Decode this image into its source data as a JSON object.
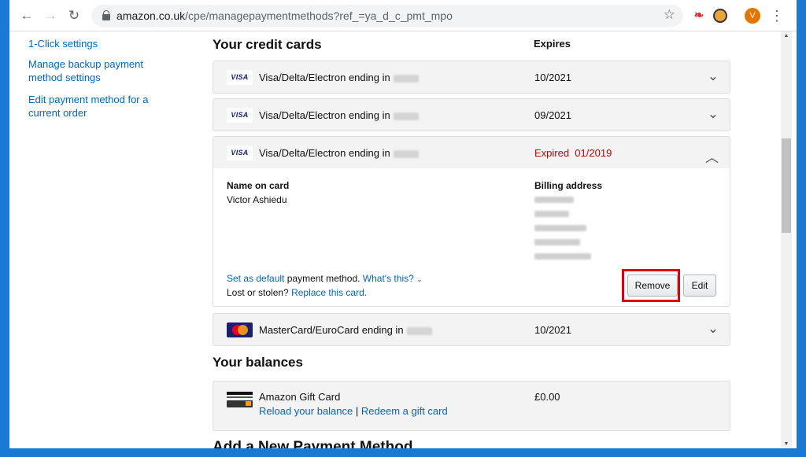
{
  "browser": {
    "back_icon": "back-arrow-icon",
    "forward_icon": "forward-arrow-icon",
    "reload_icon": "reload-icon",
    "url_host": "amazon.co.uk",
    "url_path": "/cpe/managepaymentmethods?ref_=ya_d_c_pmt_mpo",
    "avatar_letter": "V"
  },
  "sidebar": {
    "links": [
      "1-Click settings",
      "Manage backup payment method settings",
      "Edit payment method for a current order"
    ]
  },
  "credit_cards": {
    "title": "Your credit cards",
    "expires_header": "Expires",
    "cards": [
      {
        "name": "Visa/Delta/Electron",
        "ending_text": "ending in",
        "expiry": "10/2021",
        "logo": "VISA",
        "expanded": false
      },
      {
        "name": "Visa/Delta/Electron",
        "ending_text": "ending in",
        "expiry": "09/2021",
        "logo": "VISA",
        "expanded": false
      },
      {
        "name": "Visa/Delta/Electron",
        "ending_text": "ending in",
        "expiry": "Expired  01/2019",
        "logo": "VISA",
        "expanded": true
      },
      {
        "name": "MasterCard/EuroCard",
        "ending_text": "ending in",
        "expiry": "10/2021",
        "logo": "mastercard",
        "expanded": false
      }
    ],
    "details": {
      "name_label": "Name on card",
      "name_value": "Victor Ashiedu",
      "billing_label": "Billing address",
      "set_default_link": "Set as default",
      "payment_method_text": "payment method.",
      "whats_this_link": "What's this?",
      "lost_text": "Lost or stolen?",
      "replace_link": "Replace this card.",
      "remove_button": "Remove",
      "edit_button": "Edit"
    }
  },
  "balances": {
    "title": "Your balances",
    "gift_card_name": "Amazon Gift Card",
    "gift_card_amount": "£0.00",
    "reload_link": "Reload your balance",
    "separator": "|",
    "redeem_link": "Redeem a gift card"
  },
  "next_section_title": "Add a New Payment Method",
  "colors": {
    "link": "#0066c0",
    "expired": "#c40000",
    "highlight": "#e00000"
  }
}
